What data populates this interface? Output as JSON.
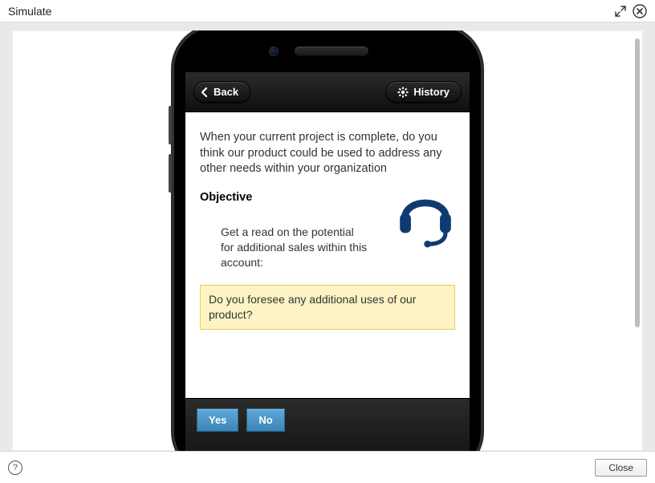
{
  "header": {
    "title": "Simulate"
  },
  "app": {
    "nav": {
      "back_label": "Back",
      "history_label": "History"
    },
    "question_text": "When your current project is complete, do you think our product could be used to address any other needs within your organization",
    "objective_label": "Objective",
    "objective_text": "Get a read on the potential for additional sales within this account:",
    "prompt_text": "Do you foresee any additional uses of our product?",
    "buttons": {
      "yes_label": "Yes",
      "no_label": "No"
    }
  },
  "footer": {
    "close_label": "Close",
    "help_glyph": "?"
  }
}
